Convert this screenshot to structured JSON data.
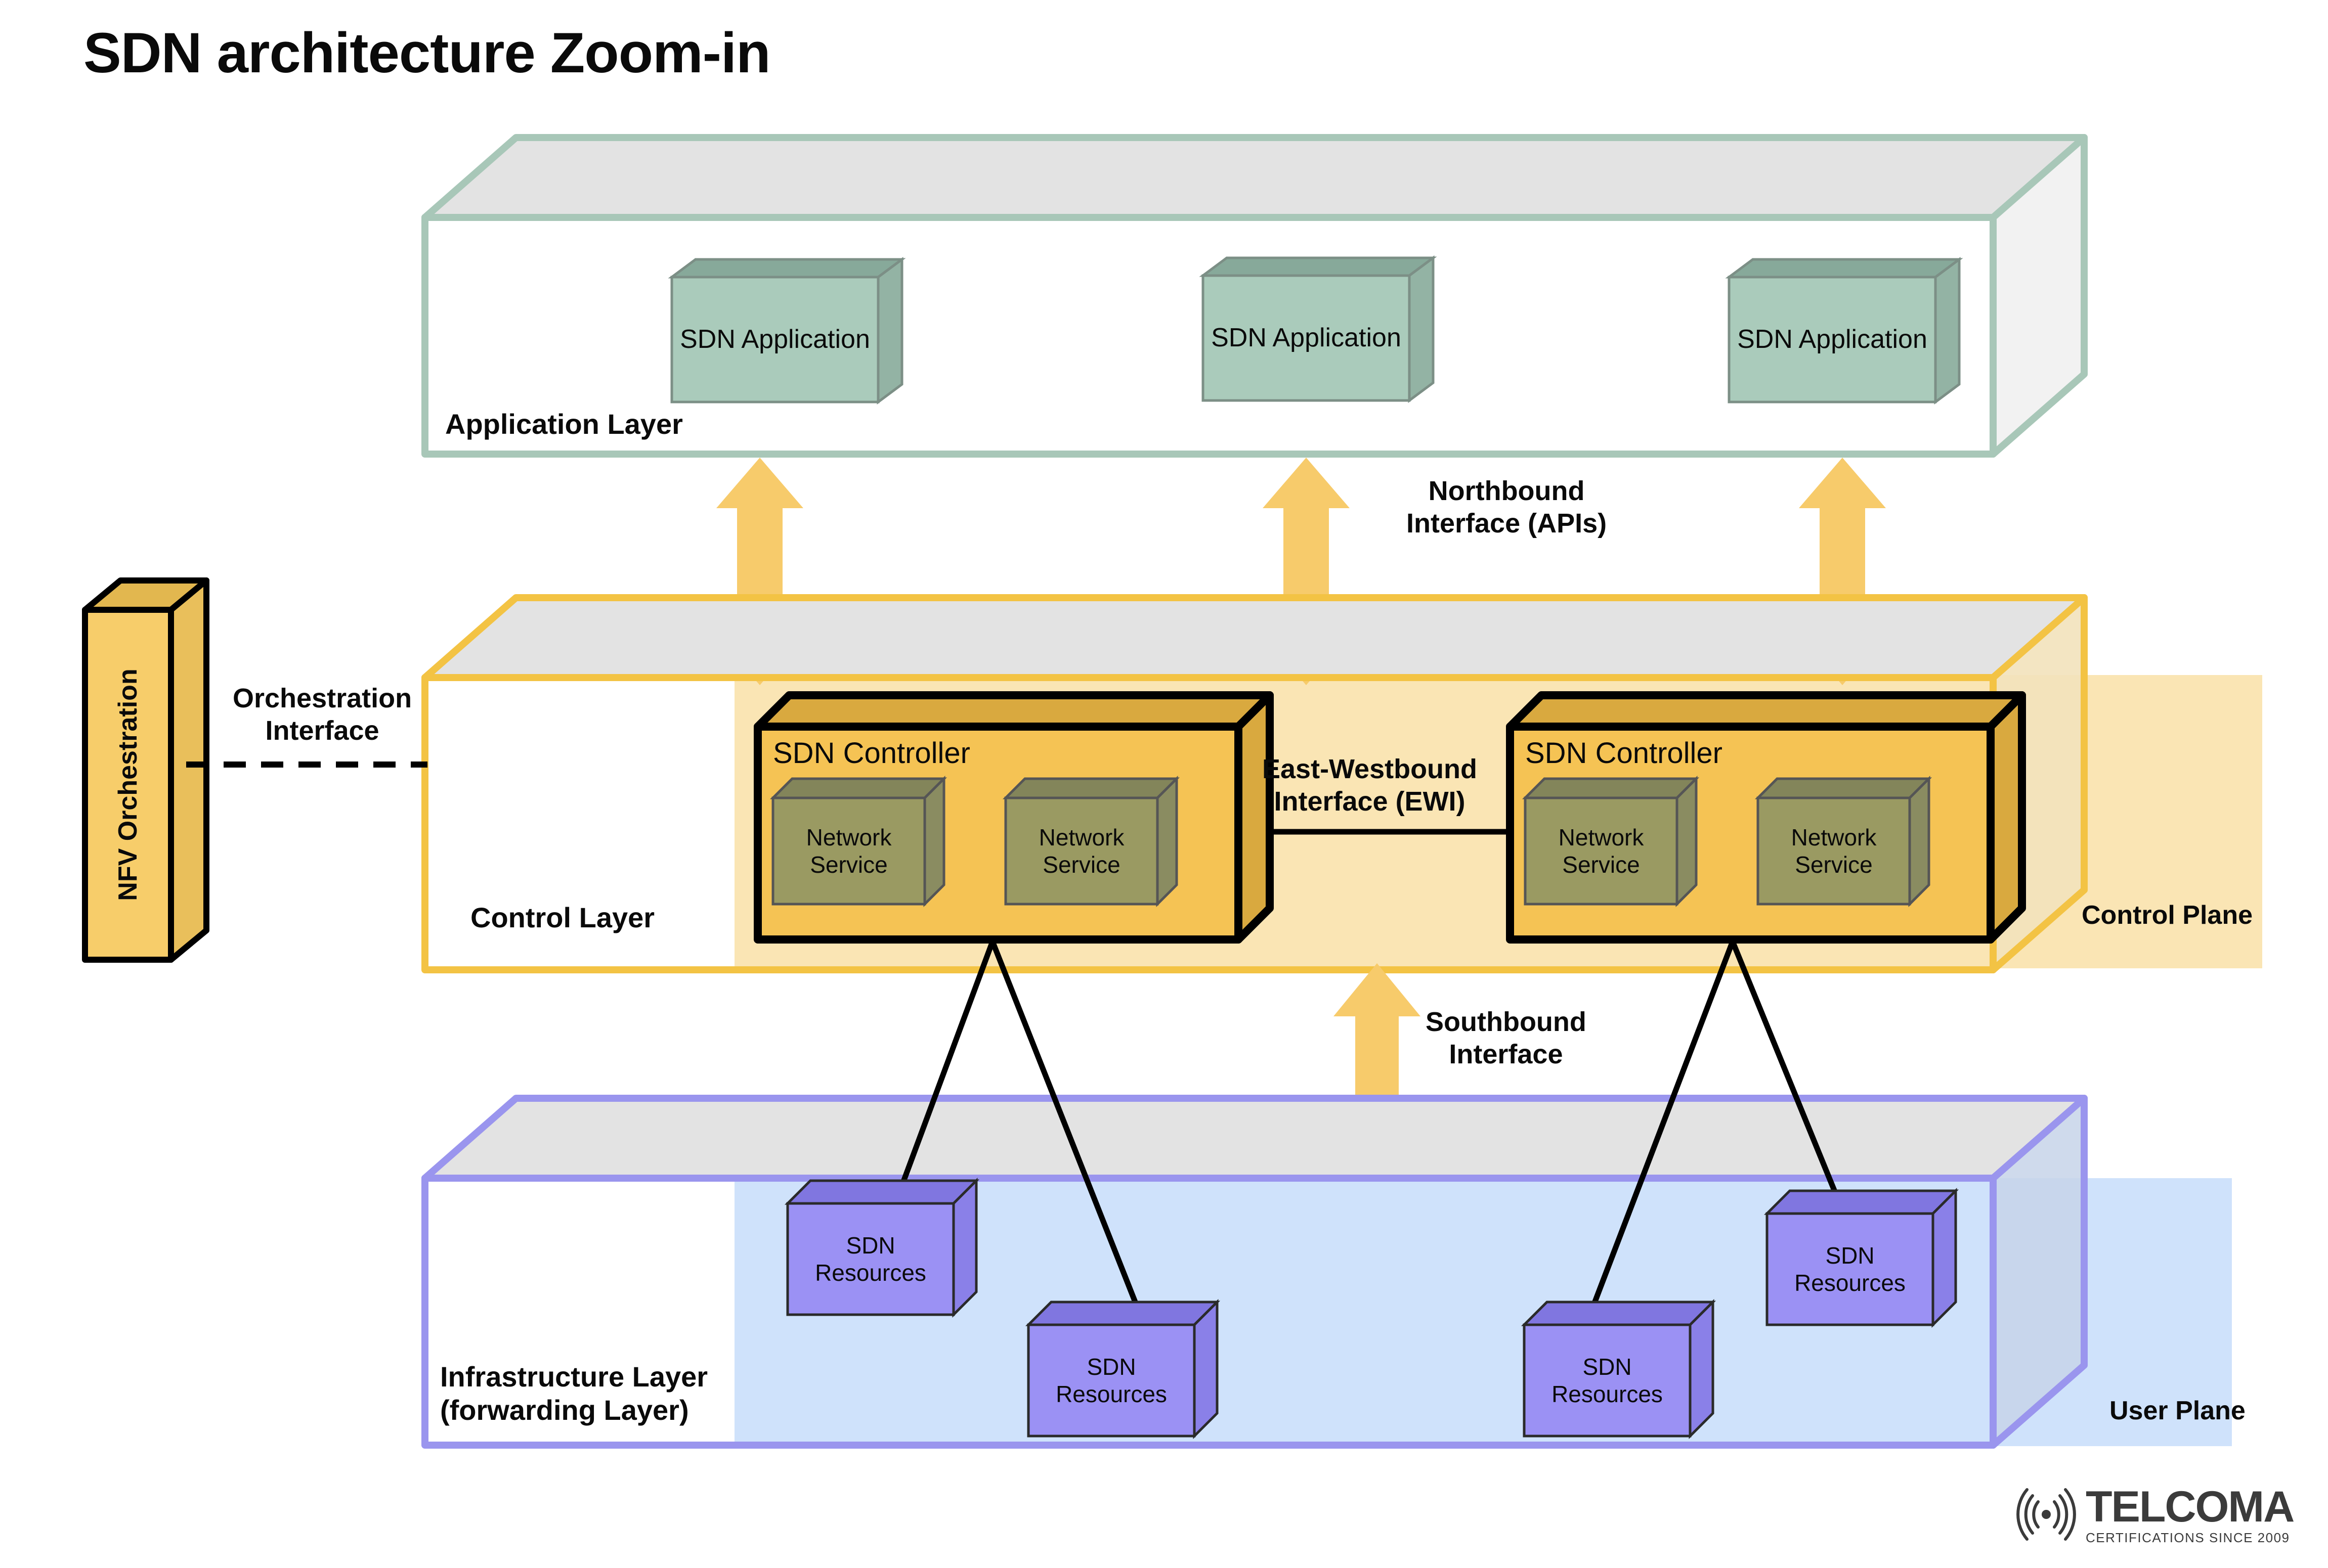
{
  "title": "SDN architecture Zoom-in",
  "layers": {
    "application": {
      "name": "Application Layer",
      "boxes": [
        {
          "label": "SDN Application"
        },
        {
          "label": "SDN Application"
        },
        {
          "label": "SDN Application"
        }
      ],
      "edge_color": "#a8c7b8",
      "box_color": "#a8cbbb"
    },
    "control": {
      "name": "Control Layer",
      "plane_label": "Control Plane",
      "edge_color": "#f3c344",
      "plane_fill": "#fae5b4",
      "controllers": [
        {
          "label": "SDN Controller",
          "services": [
            {
              "label": "Network\nService"
            },
            {
              "label": "Network\nService"
            }
          ]
        },
        {
          "label": "SDN Controller",
          "services": [
            {
              "label": "Network\nService"
            },
            {
              "label": "Network\nService"
            }
          ]
        }
      ],
      "controller_color": "#f5c354",
      "service_color": "#9a9a62"
    },
    "infrastructure": {
      "name": "Infrastructure Layer\n(forwarding Layer)",
      "plane_label": "User Plane",
      "edge_color": "#9a95ee",
      "plane_fill": "#cfe2fb",
      "boxes": [
        {
          "label": "SDN\nResources"
        },
        {
          "label": "SDN\nResources"
        },
        {
          "label": "SDN\nResources"
        },
        {
          "label": "SDN\nResources"
        }
      ],
      "box_color": "#9b91f4"
    }
  },
  "orchestration": {
    "box_label": "NFV Orchestration",
    "interface_label": "Orchestration\nInterface",
    "color": "#f7cd6a"
  },
  "interfaces": {
    "northbound": "Northbound\nInterface (APIs)",
    "eastwest": "East-Westbound\nInterface (EWI)",
    "southbound": "Southbound\nInterface",
    "arrow_color": "#f7cb6b"
  },
  "logo": {
    "name": "TELCOMA",
    "tagline": "CERTIFICATIONS SINCE 2009",
    "icon": "wifi-signal-icon"
  },
  "colors": {
    "slab_top": "#e3e3e3",
    "background": "#ffffff"
  }
}
